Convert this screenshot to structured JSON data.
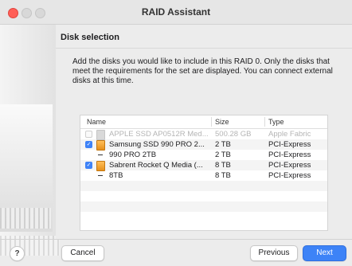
{
  "window": {
    "title": "RAID Assistant"
  },
  "section": {
    "header": "Disk selection"
  },
  "description": "Add the disks you would like to include in this RAID 0. Only the disks that meet the requirements for the set are displayed. You can connect external disks at this time.",
  "table": {
    "columns": [
      "Name",
      "Size",
      "Type"
    ],
    "rows": [
      {
        "name": "APPLE SSD AP0512R Med...",
        "size": "500.28 GB",
        "type": "Apple Fabric",
        "checked": false,
        "disabled": true,
        "kind": "disk"
      },
      {
        "name": "Samsung SSD 990 PRO 2...",
        "size": "2 TB",
        "type": "PCI-Express",
        "checked": true,
        "disabled": false,
        "kind": "disk"
      },
      {
        "name": "990 PRO 2TB",
        "size": "2 TB",
        "type": "PCI-Express",
        "checked": null,
        "disabled": false,
        "kind": "partition"
      },
      {
        "name": "Sabrent Rocket Q Media (...",
        "size": "8 TB",
        "type": "PCI-Express",
        "checked": true,
        "disabled": false,
        "kind": "disk"
      },
      {
        "name": "8TB",
        "size": "8 TB",
        "type": "PCI-Express",
        "checked": null,
        "disabled": false,
        "kind": "partition"
      }
    ]
  },
  "buttons": {
    "help": "?",
    "cancel": "Cancel",
    "previous": "Previous",
    "next": "Next"
  },
  "colors": {
    "accent": "#3d83f7",
    "disk_icon": "#f0a030"
  }
}
